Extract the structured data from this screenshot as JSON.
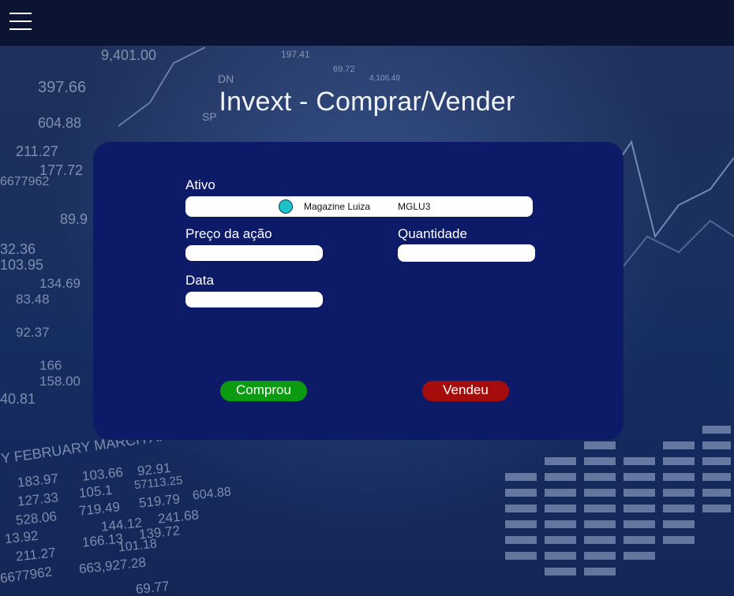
{
  "header": {
    "menu_icon": "hamburger-menu-icon"
  },
  "page": {
    "title": "Invext - Comprar/Vender"
  },
  "form": {
    "asset_label": "Ativo",
    "asset_selected": {
      "name": "Magazine Luiza",
      "ticker": "MGLU3"
    },
    "price_label": "Preço da ação",
    "price_value": "",
    "quantity_label": "Quantidade",
    "quantity_value": "",
    "date_label": "Data",
    "date_value": ""
  },
  "actions": {
    "bought_label": "Comprou",
    "sold_label": "Vendeu"
  },
  "colors": {
    "topbar": "#0b1533",
    "card": "#0c1a68",
    "buy": "#0c9a12",
    "sell": "#a50d0d",
    "asset_dot": "#1cc2c9"
  },
  "background_ticker": {
    "left_numbers": [
      "9,401.00",
      "397.66",
      "604.88",
      "211.27",
      "177.72",
      "6677962",
      "89.9",
      "32.36",
      "103.95",
      "134.69",
      "83.48",
      "92.37",
      "166",
      "158.00",
      "40.81"
    ],
    "months": "Y FEBRUARY MARCH APRIL MAY JUN",
    "bottom_numbers": [
      "183.97",
      "103.66",
      "92.91",
      "127.33",
      "105.1",
      "57113.25",
      "528.06",
      "719.49",
      "519.79",
      "604.88",
      "13.92",
      "144.12",
      "241.68",
      "211.27",
      "166.13",
      "139.72",
      "6677962",
      "663,927.28",
      "101.18",
      "69.77"
    ],
    "top_numbers": [
      "197.41",
      "69.72",
      "4,106.49",
      "DN",
      "SP"
    ]
  }
}
